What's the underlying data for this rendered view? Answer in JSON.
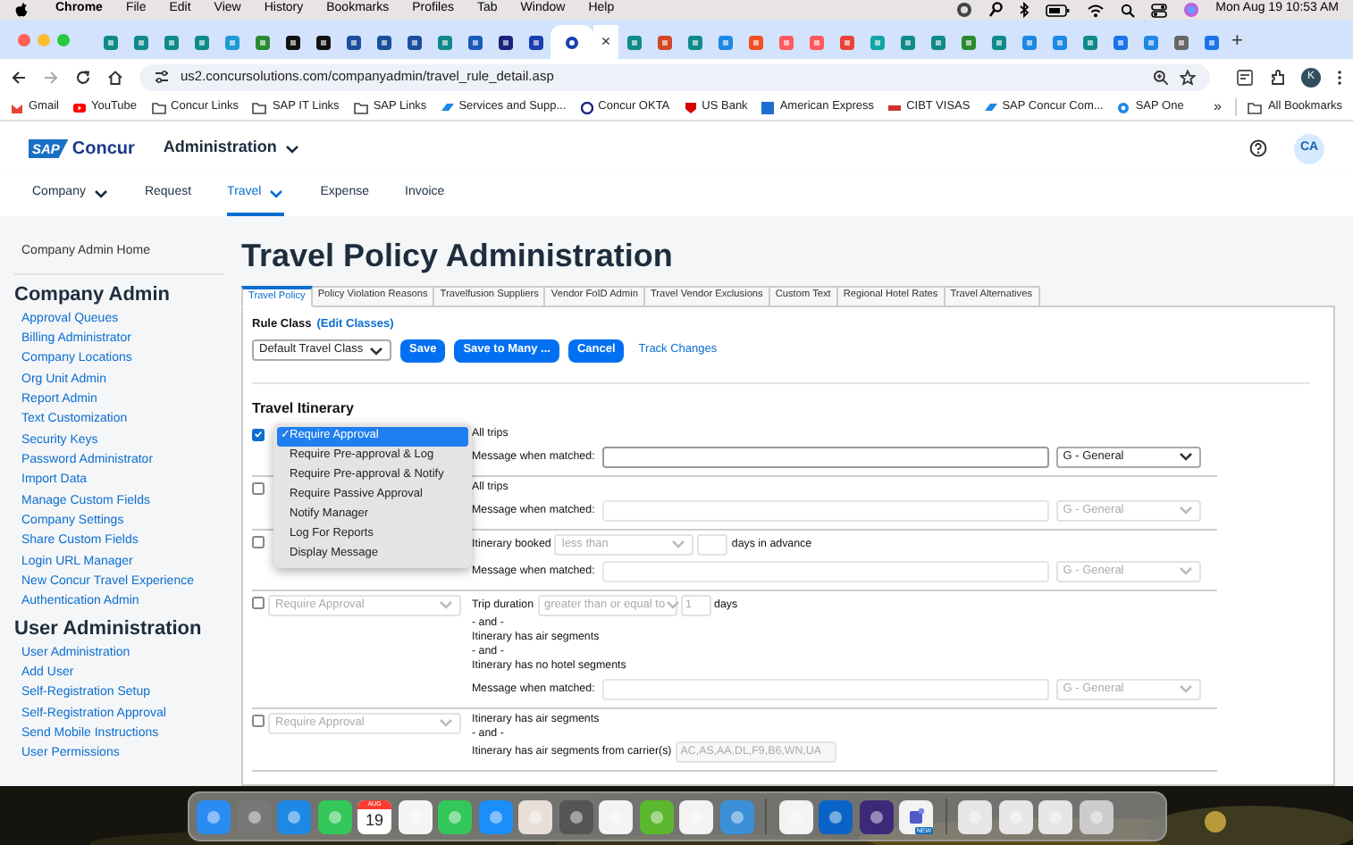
{
  "menu_bar": {
    "app": "Chrome",
    "items": [
      "File",
      "Edit",
      "View",
      "History",
      "Bookmarks",
      "Profiles",
      "Tab",
      "Window",
      "Help"
    ],
    "clock": "Mon Aug 19  10:53 AM"
  },
  "browser": {
    "close_tab": "×",
    "new_tab": "+",
    "url": "us2.concursolutions.com/companyadmin/travel_rule_detail.asp",
    "profile": "K",
    "bookmarks": [
      {
        "label": "Gmail"
      },
      {
        "label": "YouTube"
      },
      {
        "label": "Concur Links"
      },
      {
        "label": "SAP IT Links"
      },
      {
        "label": "SAP Links"
      },
      {
        "label": "Services and Supp..."
      },
      {
        "label": "Concur OKTA"
      },
      {
        "label": "US Bank"
      },
      {
        "label": "American Express"
      },
      {
        "label": "CIBT VISAS"
      },
      {
        "label": "SAP Concur Com..."
      },
      {
        "label": "SAP One"
      }
    ],
    "overflow": "»",
    "all_bookmarks": "All Bookmarks"
  },
  "app_header": {
    "logo_mark": "SAP",
    "brand": "Concur",
    "module": "Administration",
    "avatar": "CA",
    "nav": [
      {
        "label": "Company",
        "has_menu": true,
        "selected": false
      },
      {
        "label": "Request",
        "has_menu": false,
        "selected": false
      },
      {
        "label": "Travel",
        "has_menu": true,
        "selected": true
      },
      {
        "label": "Expense",
        "has_menu": false,
        "selected": false
      },
      {
        "label": "Invoice",
        "has_menu": false,
        "selected": false
      }
    ]
  },
  "sidebar": {
    "home": "Company Admin Home",
    "sections": [
      {
        "title": "Company Admin",
        "items": [
          "Approval Queues",
          "Billing Administrator",
          "Company Locations",
          "Org Unit Admin",
          "Report Admin",
          "Text Customization",
          "Security Keys",
          "Password Administrator",
          "Import Data",
          "Manage Custom Fields",
          "Company Settings",
          "Share Custom Fields",
          "Login URL Manager",
          "New Concur Travel Experience",
          "Authentication Admin"
        ]
      },
      {
        "title": "User Administration",
        "items": [
          "User Administration",
          "Add User",
          "Self-Registration Setup",
          "Self-Registration Approval",
          "Send Mobile Instructions",
          "User Permissions"
        ]
      }
    ]
  },
  "main": {
    "title": "Travel Policy Administration",
    "tabs": [
      {
        "label": "Travel Policy",
        "selected": true
      },
      {
        "label": "Policy Violation Reasons",
        "selected": false
      },
      {
        "label": "Travelfusion Suppliers",
        "selected": false
      },
      {
        "label": "Vendor FoID Admin",
        "selected": false
      },
      {
        "label": "Travel Vendor Exclusions",
        "selected": false
      },
      {
        "label": "Custom Text",
        "selected": false
      },
      {
        "label": "Regional Hotel Rates",
        "selected": false
      },
      {
        "label": "Travel Alternatives",
        "selected": false
      }
    ],
    "rule_class_label": "Rule Class",
    "edit_classes": "(Edit Classes)",
    "rule_class": "Default Travel Class",
    "buttons": [
      "Save",
      "Save to Many ...",
      "Cancel"
    ],
    "track_changes": "Track Changes",
    "section_title": "Travel Itinerary",
    "rules": [
      {
        "checked": true,
        "conditions": [
          {
            "kind": "text",
            "text": "All trips"
          }
        ],
        "message_label": "Message when matched:",
        "category": "G - General"
      },
      {
        "checked": false,
        "conditions": [
          {
            "kind": "text",
            "text": "All trips"
          }
        ],
        "message_label": "Message when matched:",
        "category": "G - General"
      },
      {
        "checked": false,
        "conditions": [
          {
            "kind": "inline",
            "parts": [
              {
                "kind": "label",
                "text": "Itinerary booked"
              },
              {
                "kind": "select",
                "value": "less than"
              },
              {
                "kind": "input"
              },
              {
                "kind": "label",
                "text": "days in advance"
              }
            ]
          }
        ],
        "message_label": "Message when matched:",
        "category": "G - General"
      },
      {
        "checked": false,
        "action": "Require Approval",
        "conditions": [
          {
            "kind": "inline",
            "parts": [
              {
                "kind": "label",
                "text": "Trip duration"
              },
              {
                "kind": "select",
                "value": "greater than or equal to"
              },
              {
                "kind": "input",
                "value": "1"
              },
              {
                "kind": "label",
                "text": "days"
              }
            ]
          },
          {
            "kind": "text",
            "text": "- and -"
          },
          {
            "kind": "text",
            "text": "Itinerary has air segments"
          },
          {
            "kind": "text",
            "text": "- and -"
          },
          {
            "kind": "text",
            "text": "Itinerary has no hotel segments"
          }
        ],
        "message_label": "Message when matched:",
        "category": "G - General"
      },
      {
        "checked": false,
        "action": "Require Approval",
        "conditions": [
          {
            "kind": "text",
            "text": "Itinerary has air segments"
          },
          {
            "kind": "text",
            "text": "- and -"
          },
          {
            "kind": "inline",
            "parts": [
              {
                "kind": "label",
                "text": "Itinerary has air segments from carrier(s)"
              },
              {
                "kind": "input",
                "value": "AC,AS,AA,DL,F9,B6,WN,UA"
              }
            ]
          }
        ]
      }
    ],
    "action_menu": {
      "check": "✓",
      "options": [
        {
          "label": "Require Approval",
          "selected": true
        },
        {
          "label": "Require Pre-approval & Log",
          "selected": false
        },
        {
          "label": "Require Pre-approval & Notify",
          "selected": false
        },
        {
          "label": "Require Passive Approval",
          "selected": false
        },
        {
          "label": "Notify Manager",
          "selected": false
        },
        {
          "label": "Log For Reports",
          "selected": false
        },
        {
          "label": "Display Message",
          "selected": false
        }
      ]
    }
  },
  "dock": {
    "calendar_month": "AUG",
    "calendar_day": "19",
    "teams_badge": "NEW"
  }
}
